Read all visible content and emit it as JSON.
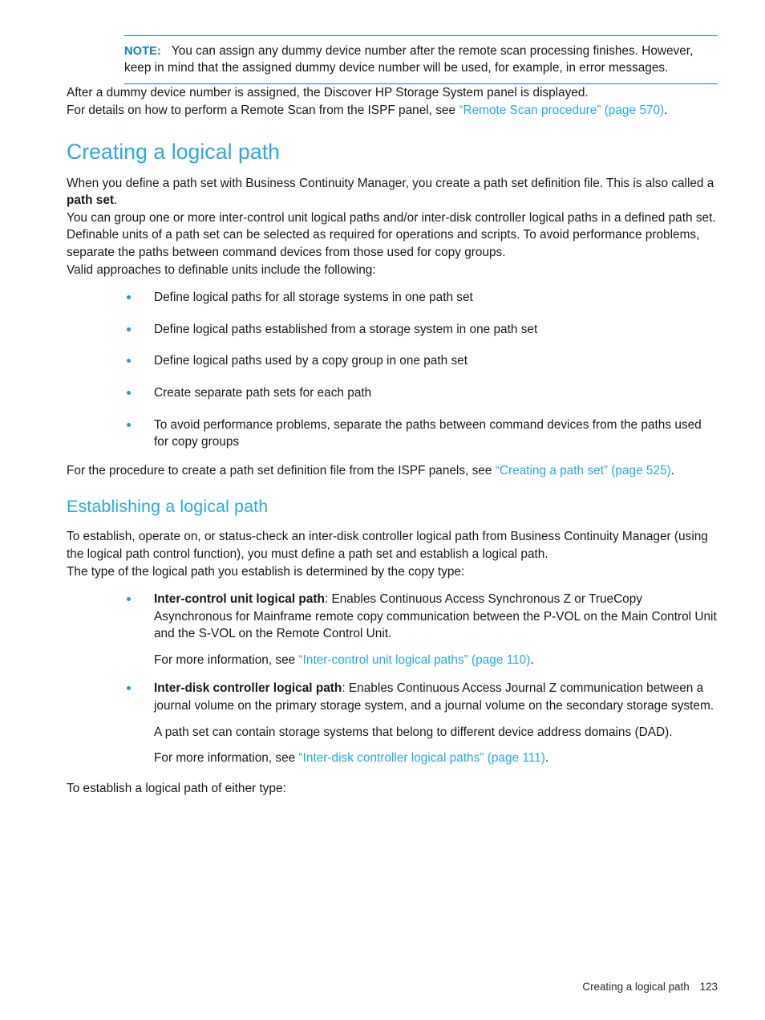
{
  "note": {
    "label": "NOTE:",
    "text": "You can assign any dummy device number after the remote scan processing finishes. However, keep in mind that the assigned dummy device number will be used, for example, in error messages."
  },
  "intro": {
    "para1": "After a dummy device number is assigned, the Discover HP Storage System panel is displayed.",
    "para2_prefix": "For details on how to perform a Remote Scan from the ISPF panel, see ",
    "para2_link": "“Remote Scan procedure” (page 570)",
    "para2_suffix": "."
  },
  "section_creating": {
    "heading": "Creating a logical path",
    "para1_a": "When you define a path set with Business Continuity Manager, you create a path set definition file. This is also called a ",
    "para1_bold": "path set",
    "para1_b": ".",
    "para2": "You can group one or more inter-control unit logical paths and/or inter-disk controller logical paths in a defined path set.",
    "para3": "Definable units of a path set can be selected as required for operations and scripts. To avoid performance problems, separate the paths between command devices from those used for copy groups.",
    "para4": "Valid approaches to definable units include the following:",
    "bullets": [
      "Define logical paths for all storage systems in one path set",
      "Define logical paths established from a storage system in one path set",
      "Define logical paths used by a copy group in one path set",
      "Create separate path sets for each path",
      "To avoid performance problems, separate the paths between command devices from the paths used for copy groups"
    ],
    "para5_prefix": "For the procedure to create a path set definition file from the ISPF panels, see ",
    "para5_link": "“Creating a path set” (page 525)",
    "para5_suffix": "."
  },
  "section_establishing": {
    "heading": "Establishing a logical path",
    "para1": "To establish, operate on, or status-check an inter-disk controller logical path from Business Continuity Manager (using the logical path control function), you must define a path set and establish a logical path.",
    "para2": "The type of the logical path you establish is determined by the copy type:",
    "items": [
      {
        "term": "Inter-control unit logical path",
        "body": ": Enables Continuous Access Synchronous Z or TrueCopy Asynchronous for Mainframe remote copy communication between the P-VOL on the Main Control Unit and the S-VOL on the Remote Control Unit.",
        "sub": [
          {
            "prefix": "For more information, see ",
            "link": "“Inter-control unit logical paths” (page 110)",
            "suffix": "."
          }
        ]
      },
      {
        "term": "Inter-disk controller logical path",
        "body": ": Enables Continuous Access Journal Z communication between a journal volume on the primary storage system, and a journal volume on the secondary storage system.",
        "sub": [
          {
            "prefix": "A path set can contain storage systems that belong to different device address domains (DAD).",
            "link": "",
            "suffix": ""
          },
          {
            "prefix": "For more information, see ",
            "link": "“Inter-disk controller logical paths” (page 111)",
            "suffix": "."
          }
        ]
      }
    ],
    "closing": "To establish a logical path of either type:"
  },
  "footer": {
    "title": "Creating a logical path",
    "page": "123"
  },
  "colors": {
    "heading_blue": "#29a9e1",
    "link_blue": "#29a9e1",
    "note_rule": "#0e85c8",
    "note_label": "#0a7fc4",
    "bullet": "#1b9dd9",
    "body_text": "#1a1a1a"
  }
}
